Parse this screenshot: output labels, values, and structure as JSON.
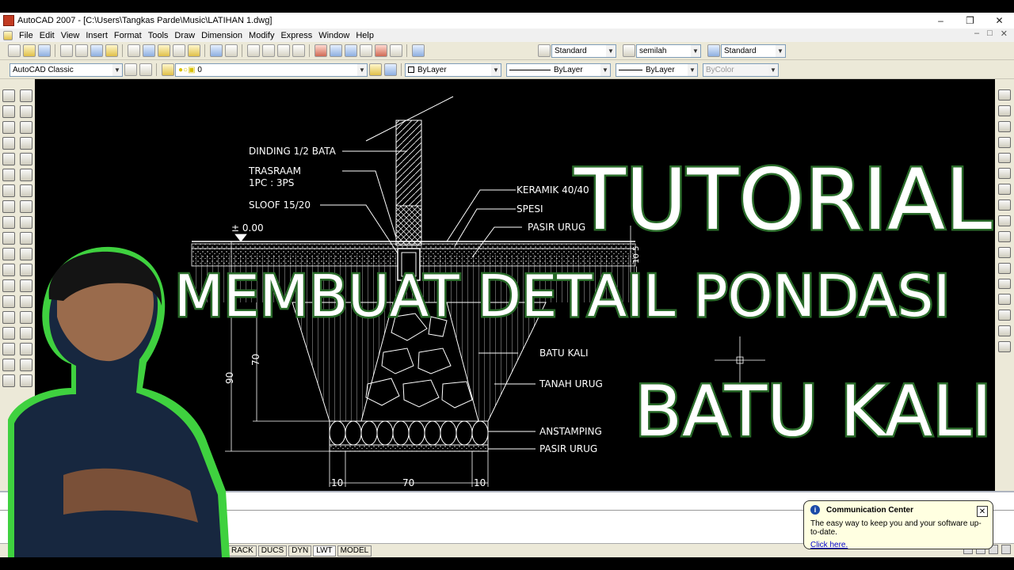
{
  "window": {
    "title": "AutoCAD 2007 - [C:\\Users\\Tangkas Parde\\Music\\LATIHAN 1.dwg]",
    "min": "–",
    "max": "❐",
    "close": "✕"
  },
  "menu": {
    "items": [
      "File",
      "Edit",
      "View",
      "Insert",
      "Format",
      "Tools",
      "Draw",
      "Dimension",
      "Modify",
      "Express",
      "Window",
      "Help"
    ],
    "mdi_min": "–",
    "mdi_max": "□",
    "mdi_close": "✕"
  },
  "styles": {
    "text_style": "Standard",
    "dim_style": "semilah",
    "table_style": "Standard"
  },
  "workspace": {
    "name": "AutoCAD Classic"
  },
  "layers": {
    "current": "0",
    "color": "ByLayer",
    "linetype": "ByLayer",
    "lineweight": "ByLayer",
    "plotstyle": "ByColor"
  },
  "drawing_labels": {
    "dinding": "DINDING 1/2 BATA",
    "trasraam1": "TRASRAAM",
    "trasraam2": "1PC : 3PS",
    "sloof": "SLOOF 15/20",
    "elevation": "± 0.00",
    "keramik": "KERAMIK 40/40",
    "spesi": "SPESI",
    "pasir_urug_top": "PASIR URUG",
    "batu_kali": "BATU KALI",
    "tanah_urug": "TANAH URUG",
    "anstamping": "ANSTAMPING",
    "pasir_urug_bottom": "PASIR URUG",
    "dim_90": "90",
    "dim_70_vert": "70",
    "dim_10_left": "10",
    "dim_70": "70",
    "dim_10_right": "10",
    "dim_right": "16 — 10 5"
  },
  "overlay": {
    "line1": "TUTORIAL",
    "line2": "MEMBUAT DETAIL PONDASI",
    "line3": "BATU KALI"
  },
  "status": {
    "items": [
      "RACK",
      "DUCS",
      "DYN",
      "LWT",
      "MODEL"
    ]
  },
  "balloon": {
    "title": "Communication Center",
    "message": "The easy way to keep you and your software up-to-date.",
    "link": "Click here.",
    "close": "✕",
    "icon": "i"
  },
  "colors": {
    "canvas": "#000000",
    "overlay_text": "#ffffff",
    "overlay_outline": "#2a6b2a",
    "person_outline": "#3fd13f"
  }
}
